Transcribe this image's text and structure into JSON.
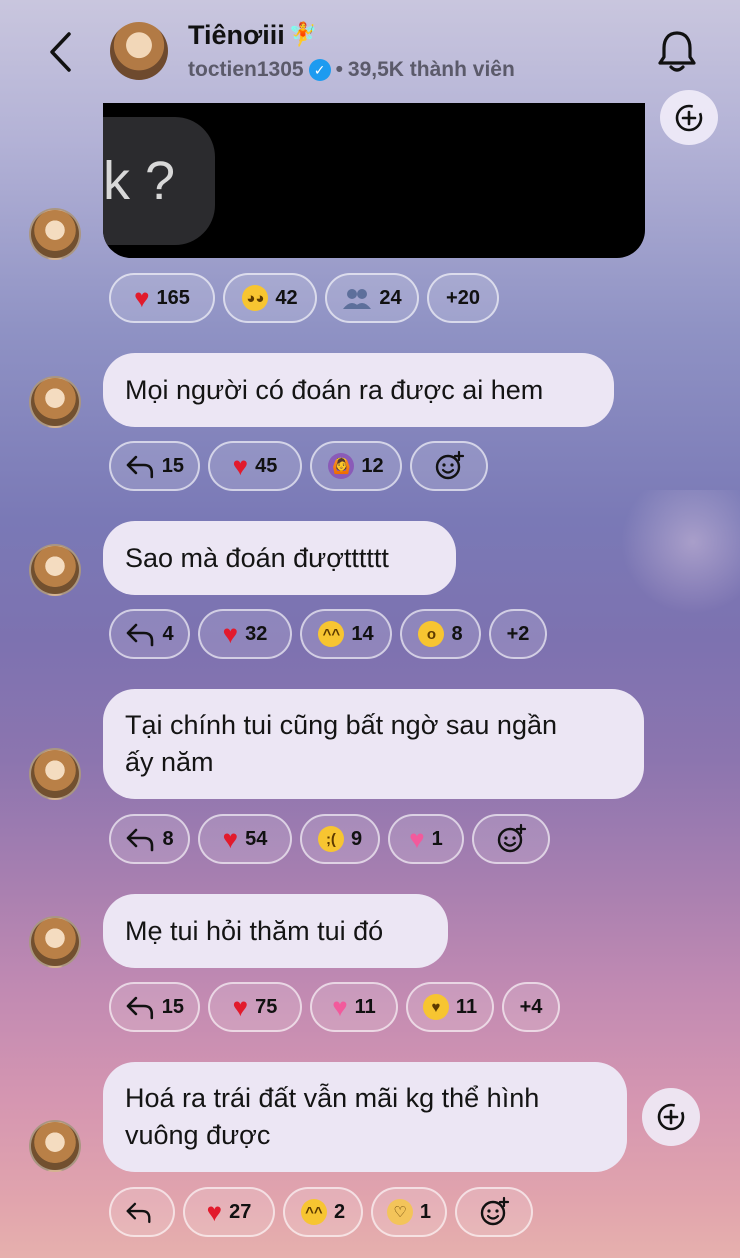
{
  "header": {
    "title": "Tiênơiii",
    "title_emoji": "🧚",
    "username": "toctien1305",
    "separator": "•",
    "members": "39,5K thành viên"
  },
  "media": {
    "preview_text": "k ?"
  },
  "media_reactions": [
    {
      "icon": "heart",
      "count": "165"
    },
    {
      "icon": "pleading-face",
      "count": "42"
    },
    {
      "icon": "people-silhouette",
      "count": "24"
    },
    {
      "icon": "more",
      "count": "+20"
    }
  ],
  "messages": [
    {
      "text": "Mọi người có đoán ra được ai hem",
      "reactions": [
        {
          "icon": "reply",
          "count": "15"
        },
        {
          "icon": "heart",
          "count": "45"
        },
        {
          "icon": "person-gesturing-ok",
          "count": "12"
        },
        {
          "icon": "add-reaction",
          "count": ""
        }
      ]
    },
    {
      "text": "Sao mà đoán đượtttttt",
      "reactions": [
        {
          "icon": "reply",
          "count": "4"
        },
        {
          "icon": "heart",
          "count": "32"
        },
        {
          "icon": "laughing-tears-face",
          "count": "14"
        },
        {
          "icon": "surprised-face",
          "count": "8"
        },
        {
          "icon": "more",
          "count": "+2"
        }
      ]
    },
    {
      "text_lines": [
        "Tại chính tui cũng bất ngờ sau ngần",
        "ấy năm"
      ],
      "reactions": [
        {
          "icon": "reply",
          "count": "8"
        },
        {
          "icon": "heart",
          "count": "54"
        },
        {
          "icon": "crying-face",
          "count": "9"
        },
        {
          "icon": "growing-heart",
          "count": "1"
        },
        {
          "icon": "add-reaction",
          "count": ""
        }
      ]
    },
    {
      "text": "Mẹ tui hỏi thăm tui đó",
      "reactions": [
        {
          "icon": "reply",
          "count": "15"
        },
        {
          "icon": "heart",
          "count": "75"
        },
        {
          "icon": "growing-heart",
          "count": "11"
        },
        {
          "icon": "smiling-face-with-hearts",
          "count": "11"
        },
        {
          "icon": "more",
          "count": "+4"
        }
      ]
    },
    {
      "text_lines": [
        "Hoá ra trái đất vẫn mãi kg thể hình",
        "vuông được"
      ],
      "reactions": [
        {
          "icon": "reply",
          "count": ""
        },
        {
          "icon": "heart",
          "count": "27"
        },
        {
          "icon": "laughing-tears-face",
          "count": "2"
        },
        {
          "icon": "heart-hands",
          "count": "1"
        },
        {
          "icon": "add-reaction",
          "count": ""
        }
      ]
    }
  ]
}
